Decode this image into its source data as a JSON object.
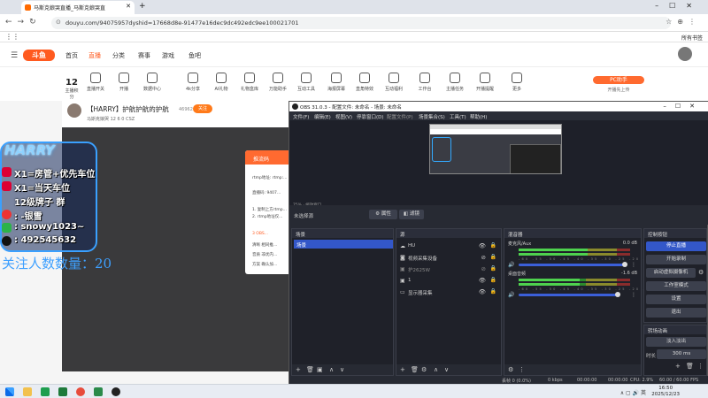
{
  "browser": {
    "tab_title": "马斯克娘哭直播_马斯克娘哭直",
    "url": "douyu.com/94075957dyshid=17668d8e-91477e16dec9dc492edc9ee100021701",
    "bookmarks_all": "所有书签"
  },
  "douyu": {
    "logo": "斗鱼",
    "nav": [
      "首页",
      "直播",
      "分类",
      "赛事",
      "游戏",
      "鱼吧"
    ],
    "right_icons": [
      "历史",
      "关注",
      "下载",
      "开播",
      "稿件"
    ],
    "level_num": "12",
    "level_label": "主播积分",
    "categories": [
      "直播开关",
      "开播",
      "数据中心",
      "4k分享",
      "AI礼物",
      "礼物盒库",
      "万能助手",
      "互动工具",
      "海报屏幕",
      "直角特效",
      "互动福利",
      "工作台",
      "主播任务",
      "开播提醒",
      "更多"
    ],
    "pc_btn": "PC助手",
    "pc_sub": "开播先上传",
    "room_title": "【HARRY】护航护航的护航",
    "room_heat": "46962",
    "follow": "关注",
    "room_meta": "马斯克娘哭  12  6  0  CSZ",
    "dialog_title": "推流码",
    "dialog_lines": [
      "rtmp地址:  rtmp:...",
      "直播码:  9407...",
      "1. 复制上方rtmp...",
      "2. rtmp地址仅...",
      "3 OBS...",
      "清晰  相同推...",
      "音质  非优内...",
      "方案  确认加..."
    ]
  },
  "overlay": {
    "title": "HARRY",
    "lines": [
      "X1=房管+优先车位",
      "X1=当天车位",
      "12级牌子  群",
      ":  -银雪",
      ":  snowy1023~",
      ":  492545632"
    ],
    "count_label": "关注人数数量：20"
  },
  "obs": {
    "title": "OBS 31.0.3 - 配置文件: 未命名 - 场景: 未命名",
    "menu": [
      "文件(F)",
      "编辑(E)",
      "视图(V)",
      "停靠窗口(D)",
      "配置文件(P)",
      "场景集合(S)",
      "工具(T)",
      "帮助(H)"
    ],
    "preview_scale": "75%  · 缩放窗口",
    "no_scene": "未选择源",
    "props": "属性",
    "filters": "滤镜",
    "docks": {
      "scenes": "场景",
      "sources": "源",
      "mixer": "混音器",
      "controls": "控制按钮",
      "transitions": "转场动画"
    },
    "scene_items": [
      "场景"
    ],
    "sources": [
      {
        "name": "HU",
        "icon": "cloud-icon"
      },
      {
        "name": "视频采集设备",
        "icon": "camera-icon"
      },
      {
        "name": "护2625W",
        "icon": "image-icon"
      },
      {
        "name": "1",
        "icon": "image-icon"
      },
      {
        "name": "显示器采集",
        "icon": "monitor-icon"
      }
    ],
    "mixer": [
      {
        "name": "麦克风/Aux",
        "db": "0.0 dB",
        "level": 0.62
      },
      {
        "name": "桌面音频",
        "db": "-1.6 dB",
        "level": 0.55
      }
    ],
    "mixer_scale": "-60 -55 -50 -45 -40 -35 -30 -25 -20 -15 -10 -5 0",
    "controls": [
      "停止直播",
      "开始录制",
      "启动虚拟摄像机",
      "工作室模式",
      "设置",
      "退出"
    ],
    "transition": "淡入淡出",
    "duration_label": "时长",
    "duration": "300 ms",
    "status": {
      "dropped": "丢帧 0 (0.0%)",
      "bitrate": "0 kbps",
      "live": "00:00:00",
      "rec": "00:00:00",
      "cpu": "CPU: 2.9%",
      "fps": "60.00 / 60.00 FPS"
    },
    "accent": "#3357c9"
  },
  "taskbar": {
    "time": "16:50",
    "date": "2025/12/23",
    "lang": "英"
  }
}
